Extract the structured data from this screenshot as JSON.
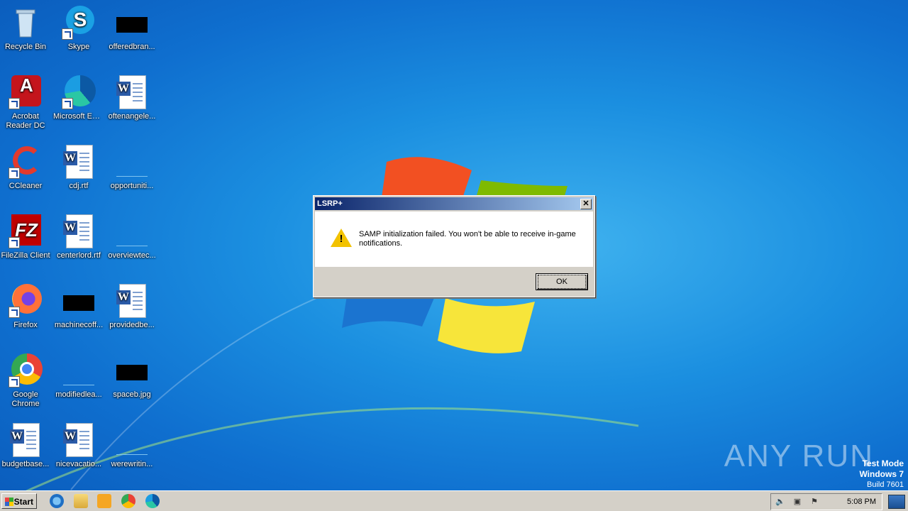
{
  "desktop": {
    "icons": [
      {
        "label": "Recycle Bin"
      },
      {
        "label": "Skype"
      },
      {
        "label": "offeredbran..."
      },
      {
        "label": "Acrobat Reader DC"
      },
      {
        "label": "Microsoft Edge"
      },
      {
        "label": "oftenangele..."
      },
      {
        "label": "CCleaner"
      },
      {
        "label": "cdj.rtf"
      },
      {
        "label": "opportuniti..."
      },
      {
        "label": "FileZilla Client"
      },
      {
        "label": "centerlord.rtf"
      },
      {
        "label": "overviewtec..."
      },
      {
        "label": "Firefox"
      },
      {
        "label": "machinecoff..."
      },
      {
        "label": "providedbe..."
      },
      {
        "label": "Google Chrome"
      },
      {
        "label": "modifiedlea..."
      },
      {
        "label": "spaceb.jpg"
      },
      {
        "label": "budgetbase..."
      },
      {
        "label": "nicevacatio..."
      },
      {
        "label": "werewritin..."
      }
    ]
  },
  "dialog": {
    "title": "LSRP+",
    "message": "SAMP initialization failed. You won't be able to receive in-game notifications.",
    "ok_label": "OK",
    "close_label": "✕",
    "icon": "warning-icon"
  },
  "watermark": {
    "text": "ANY  RUN"
  },
  "system": {
    "test_mode": "Test Mode",
    "os": "Windows 7",
    "build": "Build 7601"
  },
  "taskbar": {
    "start_label": "Start",
    "clock": "5:08 PM",
    "pinned": [
      "internet-explorer-icon",
      "file-explorer-icon",
      "media-player-icon",
      "chrome-icon",
      "edge-icon"
    ]
  }
}
